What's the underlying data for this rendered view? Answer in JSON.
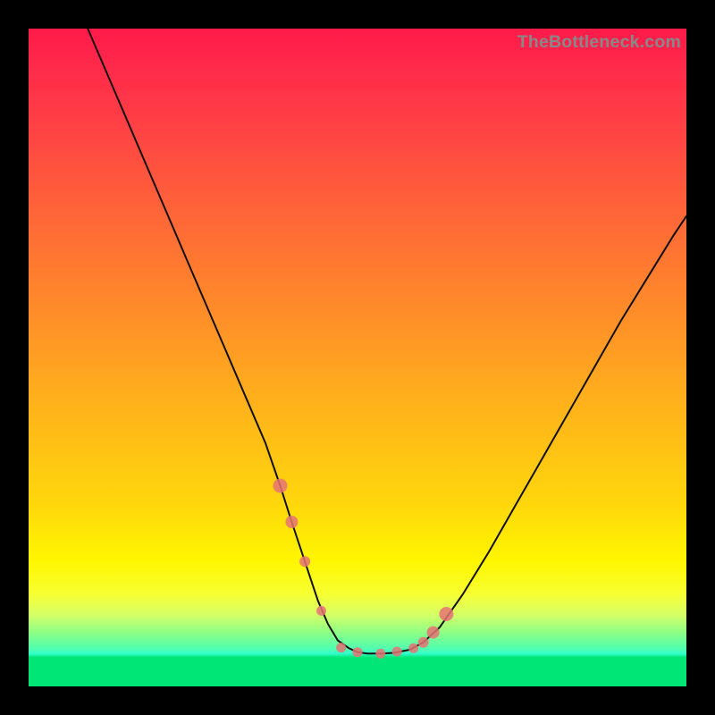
{
  "watermark": "TheBottleneck.com",
  "chart_data": {
    "type": "line",
    "title": "",
    "xlabel": "",
    "ylabel": "",
    "xlim": [
      0,
      100
    ],
    "ylim": [
      0,
      100
    ],
    "grid": false,
    "legend": false,
    "axes_visible": false,
    "series": [
      {
        "name": "curve",
        "x": [
          9,
          12,
          15,
          18,
          21,
          24,
          27,
          30,
          33,
          36,
          38.25,
          40,
          42,
          44,
          45.5,
          47,
          48.7,
          50,
          51.5,
          53.5,
          55.5,
          58,
          60,
          62.5,
          66,
          70,
          74,
          78,
          82,
          86,
          90,
          94,
          98,
          100
        ],
        "values": [
          100,
          93,
          86,
          79,
          72,
          65,
          58,
          51,
          44,
          37,
          30.5,
          25,
          19,
          13,
          9.5,
          7,
          5.8,
          5.2,
          5,
          5,
          5.1,
          5.6,
          6.7,
          9,
          14,
          20.5,
          27.5,
          34.5,
          41.5,
          48.5,
          55.5,
          62,
          68.5,
          71.5
        ]
      }
    ],
    "points": {
      "name": "dots",
      "x": [
        38.25,
        40.0,
        42.0,
        44.5,
        47.5,
        50.0,
        53.5,
        56.0,
        58.5,
        60.0,
        61.5,
        63.5
      ],
      "values": [
        30.5,
        25.0,
        19.0,
        11.5,
        5.9,
        5.2,
        5.0,
        5.3,
        5.8,
        6.7,
        8.2,
        11.0
      ],
      "radius": [
        8,
        7,
        6,
        5.5,
        5.5,
        5.5,
        5.5,
        5.5,
        5.5,
        6,
        7,
        8
      ]
    },
    "gradient_stops": [
      {
        "pos": 0.0,
        "color": "#ff1a4a"
      },
      {
        "pos": 0.06,
        "color": "#ff2a4a"
      },
      {
        "pos": 0.16,
        "color": "#ff4444"
      },
      {
        "pos": 0.3,
        "color": "#ff6a36"
      },
      {
        "pos": 0.44,
        "color": "#ff8f28"
      },
      {
        "pos": 0.58,
        "color": "#ffb41a"
      },
      {
        "pos": 0.72,
        "color": "#ffd60c"
      },
      {
        "pos": 0.81,
        "color": "#fff600"
      },
      {
        "pos": 0.86,
        "color": "#f7ff33"
      },
      {
        "pos": 0.89,
        "color": "#d7ff66"
      },
      {
        "pos": 0.92,
        "color": "#88ff88"
      },
      {
        "pos": 0.944,
        "color": "#4dffb3"
      },
      {
        "pos": 0.95,
        "color": "#33ffcc"
      },
      {
        "pos": 0.956,
        "color": "#00e676"
      },
      {
        "pos": 1.0,
        "color": "#00e676"
      }
    ]
  }
}
